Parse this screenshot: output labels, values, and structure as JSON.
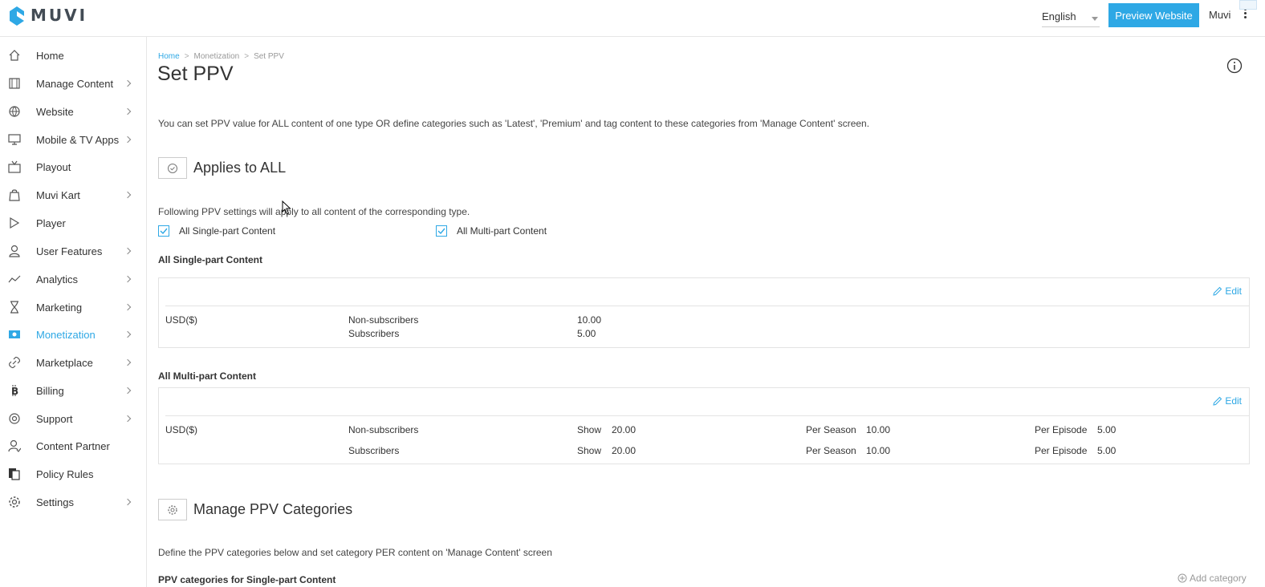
{
  "header": {
    "logo_text": "MUVI",
    "language": "English",
    "preview_button": "Preview Website",
    "user": "Muvi"
  },
  "sidebar": {
    "items": [
      {
        "label": "Home",
        "icon": "home-icon",
        "has_submenu": false
      },
      {
        "label": "Manage Content",
        "icon": "film-icon",
        "has_submenu": true
      },
      {
        "label": "Website",
        "icon": "globe-icon",
        "has_submenu": true
      },
      {
        "label": "Mobile & TV Apps",
        "icon": "monitor-icon",
        "has_submenu": true
      },
      {
        "label": "Playout",
        "icon": "tv-icon",
        "has_submenu": false
      },
      {
        "label": "Muvi Kart",
        "icon": "shopping-bag-icon",
        "has_submenu": true
      },
      {
        "label": "Player",
        "icon": "play-icon",
        "has_submenu": false
      },
      {
        "label": "User Features",
        "icon": "user-icon",
        "has_submenu": true
      },
      {
        "label": "Analytics",
        "icon": "trend-line-icon",
        "has_submenu": true
      },
      {
        "label": "Marketing",
        "icon": "hourglass-icon",
        "has_submenu": true
      },
      {
        "label": "Monetization",
        "icon": "money-icon",
        "has_submenu": true,
        "active": true
      },
      {
        "label": "Marketplace",
        "icon": "link-icon",
        "has_submenu": true
      },
      {
        "label": "Billing",
        "icon": "bitcoin-icon",
        "has_submenu": true
      },
      {
        "label": "Support",
        "icon": "lifebuoy-icon",
        "has_submenu": true
      },
      {
        "label": "Content Partner",
        "icon": "partner-icon",
        "has_submenu": false
      },
      {
        "label": "Policy Rules",
        "icon": "documents-icon",
        "has_submenu": false
      },
      {
        "label": "Settings",
        "icon": "gear-icon",
        "has_submenu": true
      }
    ]
  },
  "breadcrumb": [
    "Home",
    "Monetization",
    "Set PPV"
  ],
  "page": {
    "title": "Set PPV",
    "intro": "You can set PPV value for ALL content of one type OR define categories such as 'Latest', 'Premium' and tag content to these categories from 'Manage Content' screen."
  },
  "applies_all": {
    "title": "Applies to ALL",
    "note": "Following PPV settings will apply to all content of the corresponding type.",
    "checkboxes": [
      {
        "label": "All Single-part Content",
        "checked": true
      },
      {
        "label": "All Multi-part Content",
        "checked": true
      }
    ]
  },
  "single_part": {
    "heading": "All Single-part Content",
    "edit": "Edit",
    "currency": "USD($)",
    "rows": [
      {
        "label": "Non-subscribers",
        "value": "10.00"
      },
      {
        "label": "Subscribers",
        "value": "5.00"
      }
    ]
  },
  "multi_part": {
    "heading": "All Multi-part Content",
    "edit": "Edit",
    "currency": "USD($)",
    "col_labels": {
      "show": "Show",
      "season": "Per Season",
      "episode": "Per Episode"
    },
    "rows": [
      {
        "label": "Non-subscribers",
        "show": "20.00",
        "season": "10.00",
        "episode": "5.00"
      },
      {
        "label": "Subscribers",
        "show": "20.00",
        "season": "10.00",
        "episode": "5.00"
      }
    ]
  },
  "categories": {
    "title": "Manage PPV Categories",
    "note": "Define the PPV categories below and set category PER content on 'Manage Content' screen",
    "sub_heading": "PPV categories for Single-part Content",
    "add": "Add category"
  },
  "colors": {
    "accent": "#2ea8e5"
  }
}
